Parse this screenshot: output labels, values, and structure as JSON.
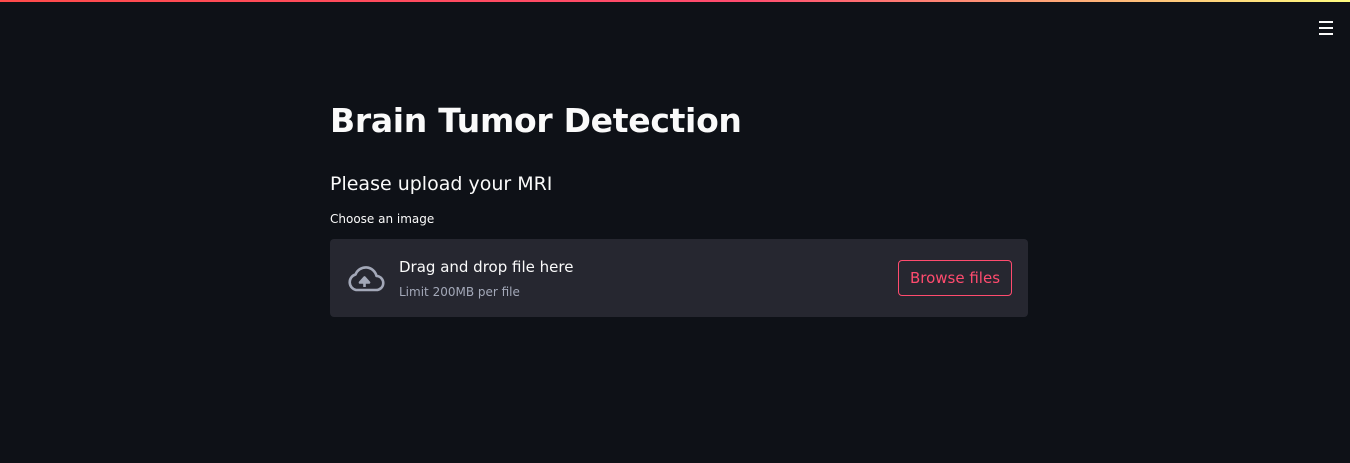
{
  "header": {
    "menu_icon": "hamburger-menu-icon",
    "decoration_gradient": [
      "#ff4b4b",
      "#fffd80"
    ]
  },
  "main": {
    "title": "Brain Tumor Detection",
    "subtitle": "Please upload your MRI",
    "uploader": {
      "label": "Choose an image",
      "icon": "cloud-upload-icon",
      "instruction": "Drag and drop file here",
      "limit": "Limit 200MB per file",
      "button_label": "Browse files"
    }
  },
  "colors": {
    "background": "#0e1117",
    "dropzone": "#262730",
    "accent": "#ff4b6e",
    "text": "#fafafa",
    "muted_text": "#a3a8b8"
  }
}
